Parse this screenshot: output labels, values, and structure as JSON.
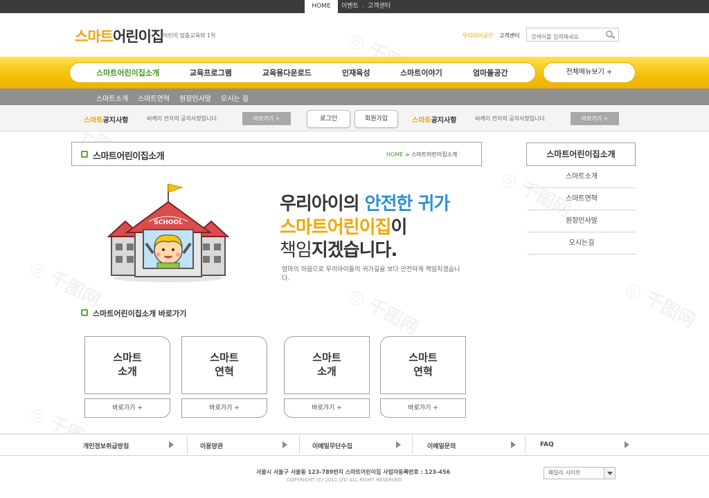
{
  "topbar": {
    "home": "HOME",
    "event": "이벤트",
    "separator": "›",
    "cs": "고객센터"
  },
  "header": {
    "logo_orange": "스마트",
    "logo_dark": "어린이집",
    "tagline": "어린이 맞춤교육의 1위",
    "link_our_kids": "우리아이공간",
    "link_cs": "고객센터",
    "search_placeholder": "검색어를 입력해세요."
  },
  "nav": {
    "items": [
      "스마트어린이집소개",
      "교육프로그램",
      "교육용다운로드",
      "인재육성",
      "스마트이야기",
      "엄마들공간"
    ],
    "all_menu": "전체메뉴보기 +"
  },
  "subnav": {
    "items": [
      "스마트소개",
      "스마트연혁",
      "원장인사말",
      "오시는 길"
    ]
  },
  "notice": {
    "title_orange": "스마트",
    "title_dark": "공지사항",
    "text": "씨케이 전자의 공지사항입니다.",
    "go": "바로가기 +",
    "login": "로그인",
    "join": "회원가입"
  },
  "content": {
    "title": "스마트어린이집소개",
    "breadcrumb_home": "HOME",
    "breadcrumb_sep": ">",
    "breadcrumb_current": "스마트어린이집소개"
  },
  "side": {
    "title": "스마트어린이집소개",
    "items": [
      "스마트소개",
      "스마트연혁",
      "원장인사말",
      "오시는길"
    ]
  },
  "hero": {
    "l1_a": "우리아이의 ",
    "l1_b": "안전한 귀가",
    "l2_a": "스마트어린이집",
    "l2_b": "이",
    "l3_a": "책임",
    "l3_b": "지겠습니다.",
    "sub": "엄마의 마음으로 우리아이들의 귀가길을 보다 안전하게 책임지겠습니다.",
    "school_sign": "SCHOOL"
  },
  "shortcuts": {
    "title": "스마트어린이집소개 바로가기",
    "cards": [
      {
        "l1": "스마트",
        "l2": "소개",
        "btn": "바로가기 +"
      },
      {
        "l1": "스마트",
        "l2": "연혁",
        "btn": "바로가기 +"
      },
      {
        "l1": "스마트",
        "l2": "소개",
        "btn": "바로가기 +"
      },
      {
        "l1": "스마트",
        "l2": "연혁",
        "btn": "바로가기 +"
      }
    ]
  },
  "footer": {
    "links": [
      "개인정보취급방침",
      "이용양관",
      "이메일무단수집",
      "이메일문의",
      "FAQ"
    ],
    "address": "서울시 서울구 서울동 123-789번지 스마트어린이집 사업자등록번호 : 123-456",
    "copyright": "COPYRIGHT (C) 2011 LTD ALL RIGHT RESERVED",
    "family_site": "패밀리 사이트"
  },
  "colors": {
    "accent_yellow": "#f6c20a",
    "logo_orange": "#f5a50a",
    "green": "#3c9a1a",
    "blue": "#2f8fd3"
  }
}
